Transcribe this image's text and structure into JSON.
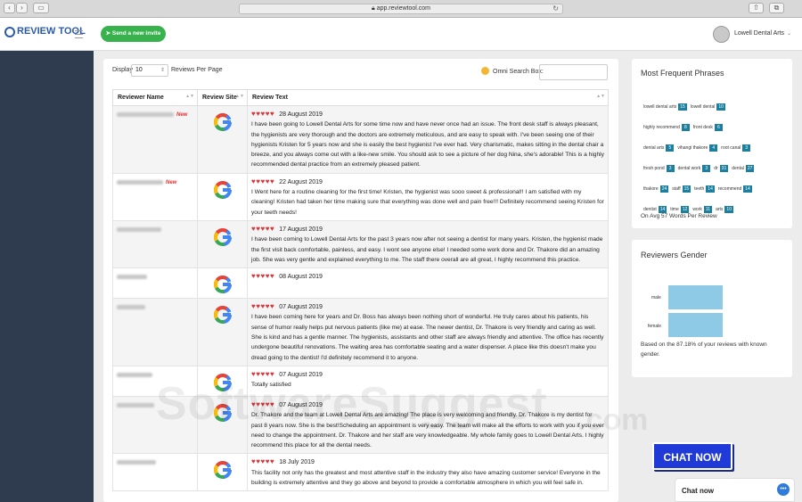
{
  "browser": {
    "url": "app.reviewtool.com"
  },
  "app": {
    "logo": "REVIEW TOOL",
    "invite_label": "Send a new invite",
    "user_name": "Lowell Dental Arts"
  },
  "controls": {
    "display_label": "Display",
    "per_page_value": "10",
    "per_page_label": "Reviews Per Page",
    "search_label": "Omni Search Box:"
  },
  "table": {
    "headers": [
      "Reviewer Name",
      "Review Site",
      "Review Text"
    ],
    "rows": [
      {
        "new": "New",
        "stars": "♥♥♥♥♥",
        "date": "28 August 2019",
        "text": "I have been going to Lowell Dental Arts for some time now and have never once had an issue. The front desk staff is always pleasant, the hygienists are very thorough and the doctors are extremely meticulous, and are easy to speak with. I've been seeing one of their hygienists Kristen for 5 years now and she is easily the best hygienist I've ever had. Very charismatic, makes sitting in the dental chair a breeze, and you always come out with a like-new smile. You should ask to see a picture of her dog Nina, she's adorable! This is a highly recommended dental practice from an extremely pleased patient."
      },
      {
        "new": "New",
        "stars": "♥♥♥♥♥",
        "date": "22 August 2019",
        "text": "I Went here for a routine cleaning for the first time! Kristen, the hygienist was sooo sweet & professional!! I am satisfied with my cleaning! Kristen had taken her time making sure that everything was done well and pain free!!! Definitely recommend seeing Kristen for your teeth needs!"
      },
      {
        "new": "",
        "stars": "♥♥♥♥♥",
        "date": "17 August 2019",
        "text": "I have been coming to Lowell Dental Arts for the past 3 years now after not seeing a dentist for many years. Kristen, the hygienist made the first visit back comfortable, painless, and easy. I wont see anyone else! I needed some work done and Dr. Thakore did an amazing job. She was very gentle and explained everything to me. The staff there overall are all great, I highly recommend this practice."
      },
      {
        "new": "",
        "stars": "♥♥♥♥♥",
        "date": "08 August 2019",
        "text": ""
      },
      {
        "new": "",
        "stars": "♥♥♥♥♥",
        "date": "07 August 2019",
        "text": "I have been coming here for years and Dr. Boss has always been nothing short of wonderful. He truly cares about his patients, his sense of humor really helps put nervous patients (like me) at ease. The newer dentist, Dr. Thakore is very friendly and caring as well. She is kind and has a gentle manner. The hygienists, assistants and other staff are always friendly and attentive. The office has recently undergone beautiful renovations. The waiting area has comfortable seating and a water dispenser. A place like this doesn't make you dread going to the dentist! I'd definitely recommend it to anyone."
      },
      {
        "new": "",
        "stars": "♥♥♥♥♥",
        "date": "07 August 2019",
        "text": "Totally satisfied"
      },
      {
        "new": "",
        "stars": "♥♥♥♥♥",
        "date": "07 August 2019",
        "text": "Dr. Thakore and the team at Lowell Dental Arts are amazing! The place is very welcoming and friendly. Dr. Thakore is my dentist for past 8 years now. She is the best!Scheduling an appointment is very easy. The team will make all the efforts to work with you if you ever need to change the appointment. Dr. Thakore and her staff are very knowledgeable. My whole family goes to Lowell Dental Arts. I highly recommend this place for all the dental needs."
      },
      {
        "new": "",
        "stars": "♥♥♥♥♥",
        "date": "18 July 2019",
        "text": "This facility not only has the greatest and most attentive staff in the industry they also have amazing customer service! Everyone in the building is extremely attentive and they go above and beyond to provide a comfortable atmosphere in which you will feel safe in."
      }
    ]
  },
  "phrases": {
    "title": "Most Frequent Phrases",
    "tags": [
      {
        "label": "lowell dental arts",
        "count": "15"
      },
      {
        "label": "lowell dental",
        "count": "10"
      },
      {
        "label": "highly recommend",
        "count": "8"
      },
      {
        "label": "front desk",
        "count": "6"
      },
      {
        "label": "dental arts",
        "count": "5"
      },
      {
        "label": "vihangi thakore",
        "count": "4"
      },
      {
        "label": "root canal",
        "count": "3"
      },
      {
        "label": "fresh pond",
        "count": "3"
      },
      {
        "label": "dental work",
        "count": "3"
      },
      {
        "label": "dr",
        "count": "31"
      },
      {
        "label": "dental",
        "count": "27"
      },
      {
        "label": "thakore",
        "count": "24"
      },
      {
        "label": "staff",
        "count": "15"
      },
      {
        "label": "teeth",
        "count": "14"
      },
      {
        "label": "recommend",
        "count": "14"
      },
      {
        "label": "dentist",
        "count": "14"
      },
      {
        "label": "time",
        "count": "12"
      },
      {
        "label": "work",
        "count": "11"
      },
      {
        "label": "arts",
        "count": "10"
      }
    ],
    "avg": "On Avg 57 Words Per Review"
  },
  "gender": {
    "title": "Reviewers Gender",
    "male_label": "male",
    "female_label": "female",
    "male_share": 0.82,
    "female_share": 0.82,
    "note": "Based on the 87.18% of your reviews with known gender."
  },
  "watermark": {
    "main": "SoftwareSuggest",
    "suffix": ".com"
  },
  "chat": {
    "badge": "CHAT NOW",
    "bar_label": "Chat now"
  },
  "colors": {
    "accent_green": "#37b24d",
    "star_red": "#d6363c",
    "sidebar": "#2f3b4f",
    "tag_blue": "#1d7fa0"
  }
}
